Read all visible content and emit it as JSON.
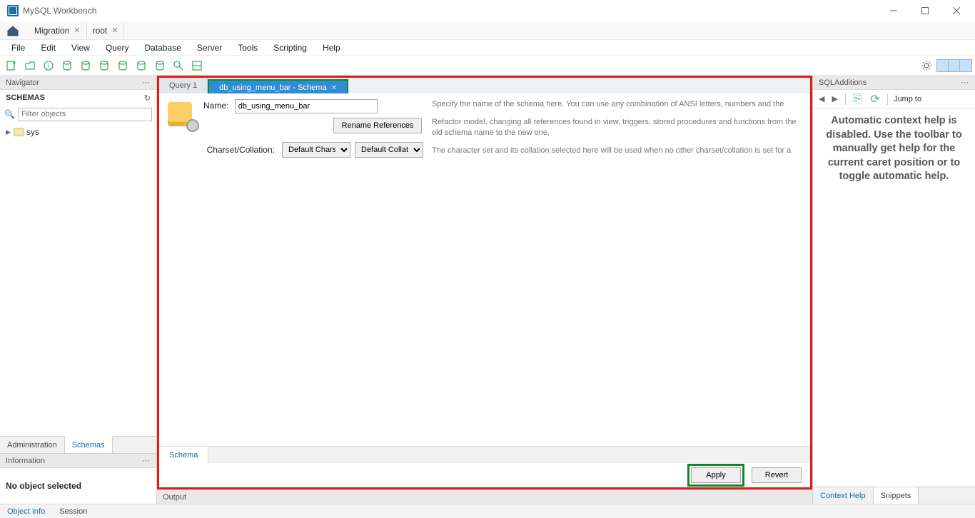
{
  "app": {
    "title": "MySQL Workbench"
  },
  "window_tabs": [
    {
      "label": "Migration"
    },
    {
      "label": "root"
    }
  ],
  "menu": [
    "File",
    "Edit",
    "View",
    "Query",
    "Database",
    "Server",
    "Tools",
    "Scripting",
    "Help"
  ],
  "navigator": {
    "title": "Navigator",
    "schemas_label": "SCHEMAS",
    "filter_placeholder": "Filter objects",
    "tree": [
      {
        "label": "sys"
      }
    ],
    "tabs": {
      "admin": "Administration",
      "schemas": "Schemas"
    },
    "info": {
      "title": "Information",
      "body": "No object selected"
    }
  },
  "editor": {
    "tabs": [
      {
        "label": "Query 1",
        "active": false
      },
      {
        "label": "db_using_menu_bar - Schema",
        "active": true
      }
    ],
    "form": {
      "name_label": "Name:",
      "name_value": "db_using_menu_bar",
      "rename_btn": "Rename References",
      "charset_label": "Charset/Collation:",
      "charset_value": "Default Charset",
      "collation_value": "Default Collation",
      "desc_name": "Specify the name of the schema here. You can use any combination of ANSI letters, numbers and the",
      "desc_rename": "Refactor model, changing all references found in view, triggers, stored procedures and functions from the old schema name to the new one.",
      "desc_charset": "The character set and its collation selected here will be used when no other charset/collation is set for a"
    },
    "subtab": "Schema",
    "apply": "Apply",
    "revert": "Revert"
  },
  "output": {
    "title": "Output"
  },
  "right": {
    "title": "SQLAdditions",
    "jump": "Jump to",
    "help_text": "Automatic context help is disabled. Use the toolbar to manually get help for the current caret position or to toggle automatic help.",
    "tabs": {
      "context": "Context Help",
      "snippets": "Snippets"
    }
  },
  "status": {
    "objinfo": "Object Info",
    "session": "Session"
  }
}
